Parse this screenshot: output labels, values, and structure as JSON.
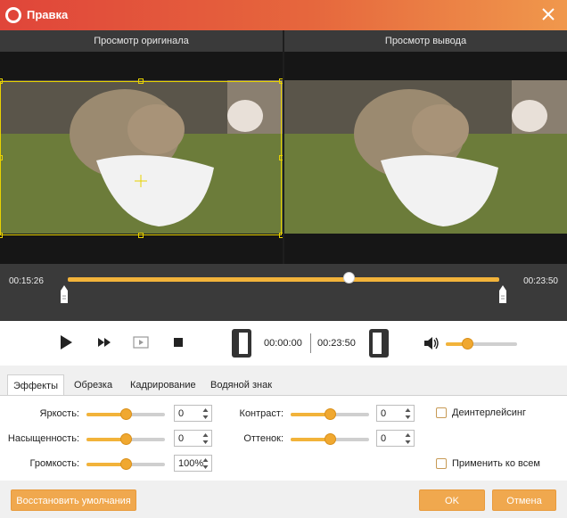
{
  "window": {
    "title": "Правка",
    "close_icon": "close-icon"
  },
  "preview": {
    "original_label": "Просмотр оригинала",
    "output_label": "Просмотр вывода"
  },
  "timeline": {
    "start_time": "00:15:26",
    "end_time": "00:23:50",
    "playhead_fraction": 0.65
  },
  "playback": {
    "clip_start": "00:00:00",
    "clip_end": "00:23:50",
    "volume_fraction": 0.3
  },
  "tabs": [
    {
      "label": "Эффекты",
      "active": true
    },
    {
      "label": "Обрезка",
      "active": false
    },
    {
      "label": "Кадрирование",
      "active": false
    },
    {
      "label": "Водяной знак",
      "active": false
    }
  ],
  "effects": {
    "brightness": {
      "label": "Яркость:",
      "value": "0",
      "level": 0.5
    },
    "saturation": {
      "label": "Насыщенность:",
      "value": "0",
      "level": 0.5
    },
    "volume": {
      "label": "Громкость:",
      "value": "100%",
      "level": 0.5
    },
    "contrast": {
      "label": "Контраст:",
      "value": "0",
      "level": 0.5
    },
    "hue": {
      "label": "Оттенок:",
      "value": "0",
      "level": 0.5
    },
    "deinterlace": {
      "label": "Деинтерлейсинг",
      "checked": false
    },
    "apply_all": {
      "label": "Применить ко всем",
      "checked": false
    }
  },
  "footer": {
    "restore_label": "Восстановить умолчания",
    "ok_label": "OK",
    "cancel_label": "Отмена"
  },
  "colors": {
    "accent": "#f2b33a",
    "title_start": "#e0453a",
    "title_end": "#f0984c"
  }
}
